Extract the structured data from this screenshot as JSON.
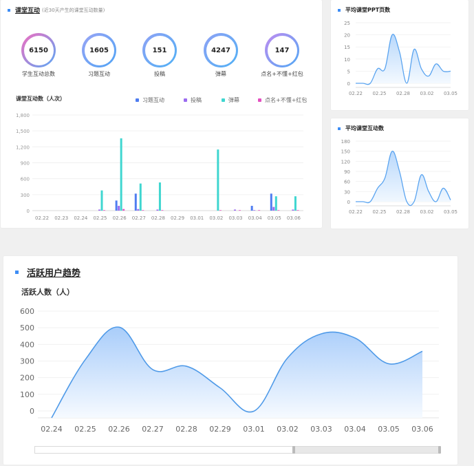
{
  "classroom": {
    "title": "课堂互动",
    "subtitle": "(近30天产生的课堂互动数量)",
    "stats": [
      {
        "label": "学生互动总数",
        "value": "6150",
        "color": "pink-blue"
      },
      {
        "label": "习题互动",
        "value": "1605",
        "color": "blue"
      },
      {
        "label": "投稿",
        "value": "151",
        "color": "blue"
      },
      {
        "label": "弹幕",
        "value": "4247",
        "color": "blue"
      },
      {
        "label": "点名+不懂+红包",
        "value": "147",
        "color": "purple-blue"
      }
    ]
  },
  "side1": {
    "title": "平均课堂PPT页数"
  },
  "side2": {
    "title": "平均课堂互动数"
  },
  "active": {
    "title": "活跃用户趋势"
  },
  "colors": {
    "accent": "#3d8df5",
    "exercise": "#4f7df0",
    "submission": "#9b6cf0",
    "danmaku": "#3fd6d0",
    "other": "#e44fc0"
  },
  "chart_data": [
    {
      "type": "bar",
      "title": "课堂互动数（人次）",
      "categories": [
        "02.22",
        "02.23",
        "02.24",
        "02.25",
        "02.26",
        "02.27",
        "02.28",
        "02.29",
        "03.01",
        "03.02",
        "03.03",
        "03.04",
        "03.05",
        "03.06"
      ],
      "yticks": [
        "1,800",
        "1,500",
        "1,200",
        "900",
        "600",
        "300",
        "0"
      ],
      "ylim": [
        0,
        1800
      ],
      "legend_position": "top-right",
      "series": [
        {
          "name": "习题互动",
          "values": [
            0,
            0,
            0,
            0,
            190,
            320,
            0,
            0,
            0,
            0,
            0,
            90,
            320,
            0
          ]
        },
        {
          "name": "投稿",
          "values": [
            0,
            0,
            0,
            20,
            90,
            30,
            20,
            0,
            0,
            0,
            20,
            10,
            70,
            20
          ]
        },
        {
          "name": "弹幕",
          "values": [
            0,
            0,
            0,
            380,
            1360,
            510,
            530,
            0,
            0,
            1150,
            0,
            0,
            270,
            270
          ]
        },
        {
          "name": "点名+不懂+红包",
          "values": [
            0,
            0,
            0,
            10,
            30,
            10,
            10,
            0,
            0,
            10,
            10,
            10,
            10,
            10
          ]
        }
      ]
    },
    {
      "type": "area",
      "categories": [
        "02.22",
        "02.25",
        "02.28",
        "03.02",
        "03.05"
      ],
      "yticks": [
        "25",
        "20",
        "15",
        "10",
        "5",
        "0"
      ],
      "ylim": [
        0,
        25
      ],
      "x": [
        0,
        1,
        2,
        3,
        4,
        5,
        6,
        7,
        8,
        9,
        10,
        11,
        12,
        13
      ],
      "values": [
        0,
        0,
        0,
        6,
        6,
        20,
        13,
        0,
        14,
        6,
        3,
        8,
        5,
        5
      ]
    },
    {
      "type": "area",
      "categories": [
        "02.22",
        "02.25",
        "02.28",
        "03.02",
        "03.05"
      ],
      "yticks": [
        "180",
        "150",
        "120",
        "90",
        "60",
        "30",
        "0"
      ],
      "ylim": [
        0,
        180
      ],
      "x": [
        0,
        1,
        2,
        3,
        4,
        5,
        6,
        7,
        8,
        9,
        10,
        11,
        12,
        13
      ],
      "values": [
        0,
        0,
        0,
        40,
        70,
        150,
        90,
        0,
        0,
        80,
        30,
        0,
        40,
        5
      ]
    },
    {
      "type": "area",
      "title": "活跃人数（人）",
      "categories": [
        "02.24",
        "02.25",
        "02.26",
        "02.27",
        "02.28",
        "02.29",
        "03.01",
        "03.02",
        "03.03",
        "03.04",
        "03.05",
        "03.06"
      ],
      "yticks": [
        "600",
        "500",
        "400",
        "300",
        "200",
        "100",
        "0"
      ],
      "ylim": [
        0,
        600
      ],
      "values": [
        0,
        350,
        545,
        290,
        310,
        180,
        40,
        360,
        505,
        480,
        325,
        400
      ]
    }
  ]
}
